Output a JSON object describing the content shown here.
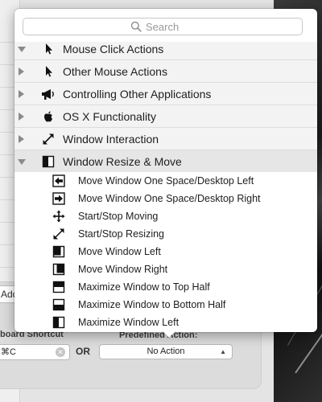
{
  "background": {
    "add_label": "Add",
    "shortcut_label": "board Shortcut",
    "shortcut_value": "⌘C",
    "or_label": "OR",
    "action_label": "Predefined Action:",
    "action_value": "No Action"
  },
  "popover": {
    "search": {
      "placeholder": "Search",
      "value": ""
    },
    "categories": [
      {
        "label": "Mouse Click Actions",
        "icon": "cursor-arrow-icon",
        "expanded": false
      },
      {
        "label": "Other Mouse Actions",
        "icon": "cursor-arrow-icon",
        "expanded": false
      },
      {
        "label": "Controlling Other Applications",
        "icon": "megaphone-icon",
        "expanded": false
      },
      {
        "label": "OS X Functionality",
        "icon": "apple-logo-icon",
        "expanded": false
      },
      {
        "label": "Window Interaction",
        "icon": "diagonal-arrows-icon",
        "expanded": false
      },
      {
        "label": "Window Resize & Move",
        "icon": "half-window-icon",
        "expanded": true
      }
    ],
    "items": [
      {
        "label": "Move Window One Space/Desktop Left",
        "icon": "window-arrow-left-icon"
      },
      {
        "label": "Move Window One Space/Desktop Right",
        "icon": "window-arrow-right-icon"
      },
      {
        "label": "Start/Stop Moving",
        "icon": "move-cross-icon"
      },
      {
        "label": "Start/Stop Resizing",
        "icon": "resize-diagonal-icon"
      },
      {
        "label": "Move Window Left",
        "icon": "window-left-half-icon"
      },
      {
        "label": "Move Window Right",
        "icon": "window-right-half-icon"
      },
      {
        "label": "Maximize Window to Top Half",
        "icon": "window-top-half-icon"
      },
      {
        "label": "Maximize Window to Bottom Half",
        "icon": "window-bottom-half-icon"
      },
      {
        "label": "Maximize Window Left",
        "icon": "window-left-side-icon"
      }
    ]
  }
}
